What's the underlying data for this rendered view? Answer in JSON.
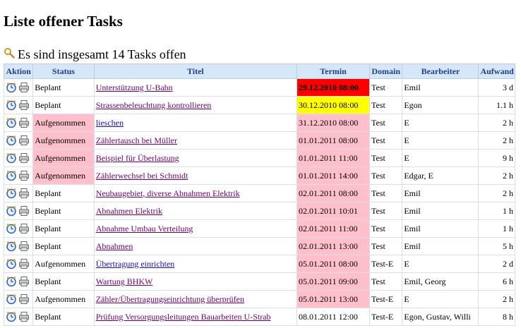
{
  "title": "Liste offener Tasks",
  "summary_text": "Es sind insgesamt 14 Tasks offen",
  "colors": {
    "header_bg": "#d6e7f7",
    "header_text": "#1f3f88",
    "overdue": "#ff0000",
    "due_soon": "#ffff00",
    "in_progress": "#ffc0cb"
  },
  "headers": [
    "Aktion",
    "Status",
    "Titel",
    "Termin",
    "Domain",
    "Bearbeiter",
    "Aufwand"
  ],
  "rows": [
    {
      "status": "Beplant",
      "titel": "Unterstützung U-Bahn",
      "termin": "29.12.2010 08:00",
      "domain": "Test",
      "bearbeiter": "Emil",
      "aufwand": "3 d",
      "status_hl": false,
      "termin_hl": "red",
      "link": "purple"
    },
    {
      "status": "Beplant",
      "titel": "Strassenbeleuchtung kontrollieren",
      "termin": "30.12.2010 08:00",
      "domain": "Test",
      "bearbeiter": "Egon",
      "aufwand": "1.1 h",
      "status_hl": false,
      "termin_hl": "yellow",
      "link": "purple"
    },
    {
      "status": "Aufgenommen",
      "titel": "lieschen",
      "termin": "31.12.2010 08:00",
      "domain": "Test",
      "bearbeiter": "E",
      "aufwand": "2 h",
      "status_hl": true,
      "termin_hl": "pink",
      "link": "blue"
    },
    {
      "status": "Aufgenommen",
      "titel": "Zählertausch bei Müller",
      "termin": "01.01.2011 08:00",
      "domain": "Test",
      "bearbeiter": "E",
      "aufwand": "2 h",
      "status_hl": true,
      "termin_hl": "pink",
      "link": "purple"
    },
    {
      "status": "Aufgenommen",
      "titel": "Beispiel für Überlastung",
      "termin": "01.01.2011 11:00",
      "domain": "Test",
      "bearbeiter": "E",
      "aufwand": "9 h",
      "status_hl": true,
      "termin_hl": "pink",
      "link": "purple"
    },
    {
      "status": "Aufgenommen",
      "titel": "Zählerwechsel bei Schmidt",
      "termin": "01.01.2011 14:00",
      "domain": "Test",
      "bearbeiter": "Edgar, E",
      "aufwand": "2 h",
      "status_hl": true,
      "termin_hl": "pink",
      "link": "purple"
    },
    {
      "status": "Beplant",
      "titel": "Neubaugebiet, diverse Abnahmen Elektrik",
      "termin": "02.01.2011 08:00",
      "domain": "Test",
      "bearbeiter": "Emil",
      "aufwand": "2 h",
      "status_hl": false,
      "termin_hl": "pink",
      "link": "purple"
    },
    {
      "status": "Beplant",
      "titel": "Abnahmen Elektrik",
      "termin": "02.01.2011 10:01",
      "domain": "Test",
      "bearbeiter": "Emil",
      "aufwand": "1 h",
      "status_hl": false,
      "termin_hl": "pink",
      "link": "purple"
    },
    {
      "status": "Beplant",
      "titel": "Abnahme Umbau Verteilung",
      "termin": "02.01.2011 11:00",
      "domain": "Test",
      "bearbeiter": "Emil",
      "aufwand": "1 h",
      "status_hl": false,
      "termin_hl": "pink",
      "link": "purple"
    },
    {
      "status": "Beplant",
      "titel": "Abnahmen",
      "termin": "02.01.2011 13:00",
      "domain": "Test",
      "bearbeiter": "Emil",
      "aufwand": "5 h",
      "status_hl": false,
      "termin_hl": "pink",
      "link": "purple"
    },
    {
      "status": "Aufgenommen",
      "titel": "Übertragung einrichten",
      "termin": "05.01.2011 08:00",
      "domain": "Test-E",
      "bearbeiter": "E",
      "aufwand": "2 d",
      "status_hl": false,
      "termin_hl": "pink",
      "link": "blue"
    },
    {
      "status": "Beplant",
      "titel": "Wartung BHKW",
      "termin": "05.01.2011 09:00",
      "domain": "Test",
      "bearbeiter": "Emil, Georg",
      "aufwand": "6 h",
      "status_hl": false,
      "termin_hl": "pink",
      "link": "purple"
    },
    {
      "status": "Aufgenommen",
      "titel": "Zähler/Übertragungseinrichtung überprüfen",
      "termin": "05.01.2011 13:00",
      "domain": "Test-E",
      "bearbeiter": "E",
      "aufwand": "2 h",
      "status_hl": false,
      "termin_hl": "pink",
      "link": "purple"
    },
    {
      "status": "Beplant",
      "titel": "Prüfung Versorgungsleitungen Bauarbeiten U-Strab",
      "termin": "08.01.2011 12:00",
      "domain": "Test-E",
      "bearbeiter": "Egon, Gustav, Willi",
      "aufwand": "8 h",
      "status_hl": false,
      "termin_hl": "none",
      "link": "purple"
    }
  ]
}
